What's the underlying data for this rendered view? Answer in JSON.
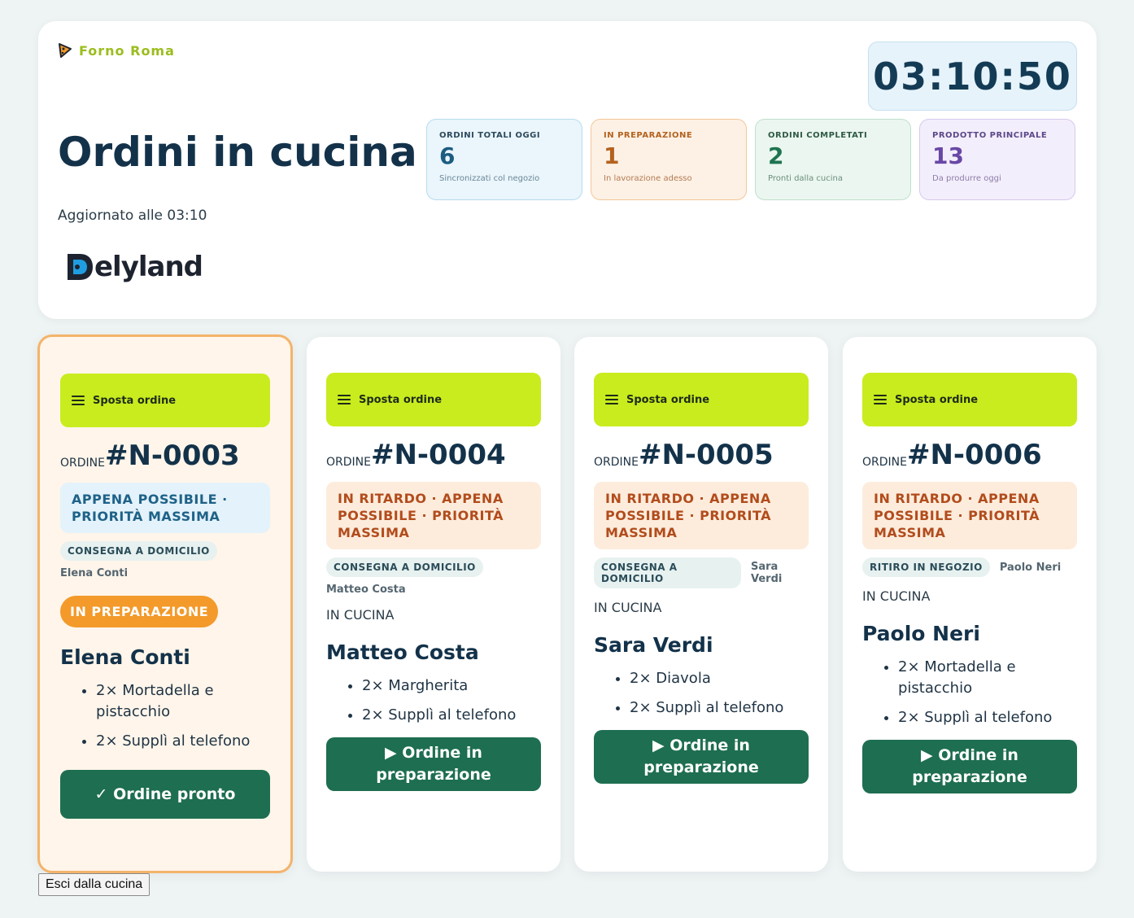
{
  "brand": {
    "name": "Forno Roma"
  },
  "header": {
    "title": "Ordini in cucina",
    "updated": "Aggiornato alle 03:10",
    "logo_text": "elyland",
    "logo_full": "Delyland",
    "clock": "03:10:50"
  },
  "stats": [
    {
      "label": "ORDINI TOTALI OGGI",
      "value": "6",
      "sub": "Sincronizzati col negozio",
      "color": "#1c5c80"
    },
    {
      "label": "IN PREPARAZIONE",
      "value": "1",
      "sub": "In lavorazione adesso",
      "color": "#b4621f"
    },
    {
      "label": "ORDINI COMPLETATI",
      "value": "2",
      "sub": "Pronti dalla cucina",
      "color": "#1e7450"
    },
    {
      "label": "PRODOTTO PRINCIPALE",
      "value": "13",
      "sub": "Da produrre oggi",
      "color": "#6847a6"
    }
  ],
  "orders": [
    {
      "move_label": "Sposta ordine",
      "prefix": "ORDINE",
      "number": "#N-0003",
      "priority": "APPENA POSSIBILE · PRIORITÀ MASSIMA",
      "tag": "CONSEGNA A DOMICILIO",
      "tag_name": "Elena Conti",
      "status": "IN PREPARAZIONE",
      "customer": "Elena Conti",
      "items": [
        "2× Mortadella e pistacchio",
        "2× Supplì al telefono"
      ],
      "action": "✓ Ordine pronto"
    },
    {
      "move_label": "Sposta ordine",
      "prefix": "ORDINE",
      "number": "#N-0004",
      "priority": "IN RITARDO · APPENA POSSIBILE · PRIORITÀ MASSIMA",
      "tag": "CONSEGNA A DOMICILIO",
      "tag_name": "Matteo Costa",
      "status": "IN CUCINA",
      "customer": "Matteo Costa",
      "items": [
        "2× Margherita",
        "2× Supplì al telefono"
      ],
      "action": "▶ Ordine in preparazione"
    },
    {
      "move_label": "Sposta ordine",
      "prefix": "ORDINE",
      "number": "#N-0005",
      "priority": "IN RITARDO · APPENA POSSIBILE · PRIORITÀ MASSIMA",
      "tag": "CONSEGNA A DOMICILIO",
      "tag_name": "Sara Verdi",
      "status": "IN CUCINA",
      "customer": "Sara Verdi",
      "items": [
        "2× Diavola",
        "2× Supplì al telefono"
      ],
      "action": "▶ Ordine in preparazione"
    },
    {
      "move_label": "Sposta ordine",
      "prefix": "ORDINE",
      "number": "#N-0006",
      "priority": "IN RITARDO · APPENA POSSIBILE · PRIORITÀ MASSIMA",
      "tag": "RITIRO IN NEGOZIO",
      "tag_name": "Paolo Neri",
      "status": "IN CUCINA",
      "customer": "Paolo Neri",
      "items": [
        "2× Mortadella e pistacchio",
        "2× Supplì al telefono"
      ],
      "action": "▶ Ordine in preparazione"
    }
  ],
  "footer": {
    "exit_label": "Esci dalla cucina"
  },
  "colors": {
    "accent_lime": "#c8ec1e",
    "action_green": "#1e6e51",
    "active_orange": "#f39a2a"
  }
}
